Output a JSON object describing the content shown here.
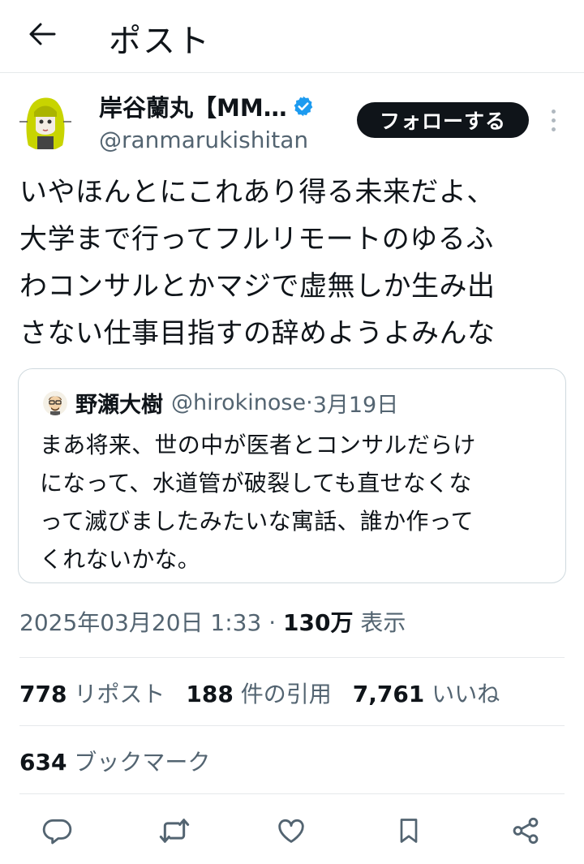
{
  "header": {
    "title": "ポスト"
  },
  "author": {
    "name": "岸谷蘭丸【MM…",
    "handle": "@ranmarukishitan",
    "follow_label": "フォローする"
  },
  "post": {
    "lines": [
      "いやほんとにこれあり得る未来だよ、",
      "大学まで行ってフルリモートのゆるふ",
      "わコンサルとかマジで虚無しか生み出",
      "さない仕事目指すの辞めようよみんな"
    ]
  },
  "quote": {
    "name": "野瀬大樹",
    "handle": "@hirokinose",
    "separator": " · ",
    "date": "3月19日",
    "lines": [
      "まあ将来、世の中が医者とコンサルだらけ",
      "になって、水道管が破裂しても直せなくな",
      "って滅びましたみたいな寓話、誰か作って",
      "くれないかな。"
    ]
  },
  "meta": {
    "datetime": "2025年03月20日 1:33",
    "separator": " · ",
    "views": "130万",
    "views_label": " 表示"
  },
  "stats": {
    "reposts": "778",
    "reposts_label": " リポスト",
    "quotes": "188",
    "quotes_label": " 件の引用",
    "likes": "7,761",
    "likes_label": " いいね",
    "bookmarks": "634",
    "bookmarks_label": " ブックマーク"
  },
  "actions": {
    "icons": [
      "reply-icon",
      "repost-icon",
      "like-icon",
      "bookmark-icon",
      "share-icon"
    ]
  },
  "colors": {
    "text": "#0f1419",
    "secondary": "#536471",
    "verified": "#1d9bf0",
    "follow_bg": "#0f1419",
    "border": "#cfd9de"
  }
}
